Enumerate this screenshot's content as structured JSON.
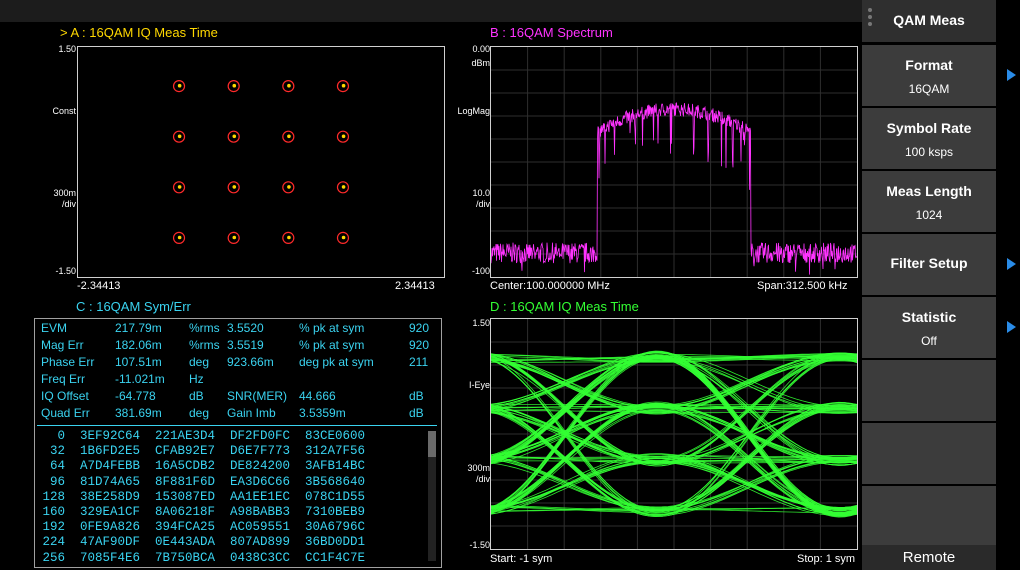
{
  "panel_a": {
    "title": ">  A :  16QAM  IQ Meas Time",
    "y_top": "1.50",
    "y_label": "Const",
    "scale_value": "300m",
    "scale_unit": "/div",
    "y_bottom": "-1.50",
    "x_left": "-2.34413",
    "x_right": "2.34413",
    "title_color": "#ffd800",
    "marker_color": "#ff2a2a",
    "point_color": "#ffd800"
  },
  "panel_b": {
    "title": "B :  16QAM  Spectrum",
    "ref_value": "0.00",
    "ref_unit": "dBm",
    "mode": "LogMag",
    "scale_value": "10.0",
    "scale_unit": "/div",
    "y_bottom": "-100",
    "center": "Center:100.000000 MHz",
    "span": "Span:312.500 kHz",
    "title_color": "#ff33ff",
    "trace_color": "#ff33ff"
  },
  "panel_c": {
    "title": "C :  16QAM  Sym/Err",
    "metrics": [
      [
        "EVM",
        "217.79m",
        "%rms",
        "3.5520",
        "% pk at sym",
        "920"
      ],
      [
        "Mag Err",
        "182.06m",
        "%rms",
        "3.5519",
        "% pk at sym",
        "920"
      ],
      [
        "Phase Err",
        "107.51m",
        "deg",
        "923.66m",
        "deg pk at sym",
        "211"
      ],
      [
        "Freq Err",
        "-11.021m",
        "Hz",
        "",
        "",
        ""
      ],
      [
        "IQ Offset",
        "-64.778",
        "dB",
        "SNR(MER)",
        "44.666",
        "dB"
      ],
      [
        "Quad Err",
        "381.69m",
        "deg",
        "Gain Imb",
        "3.5359m",
        "dB"
      ]
    ],
    "symbols": [
      "   0  3EF92C64  221AE3D4  DF2FD0FC  83CE0600",
      "  32  1B6FD2E5  CFAB92E7  D6E7F773  312A7F56",
      "  64  A7D4FEBB  16A5CDB2  DE824200  3AFB14BC",
      "  96  81D74A65  8F881F6D  EA3D6C66  3B568640",
      " 128  38E258D9  153087ED  AA1EE1EC  078C1D55",
      " 160  329EA1CF  8A06218F  A98BABB3  7310BEB9",
      " 192  0FE9A826  394FCA25  AC059551  30A6796C",
      " 224  47AF90DF  0E443ADA  807AD899  36BD0DD1",
      " 256  7085F4E6  7B750BCA  0438C3CC  CC1F4C7E"
    ],
    "title_color": "#3ad3f0"
  },
  "panel_d": {
    "title": "D :  16QAM  IQ Meas Time",
    "y_top": "1.50",
    "y_label": "I-Eye",
    "scale_value": "300m",
    "scale_unit": "/div",
    "y_bottom": "-1.50",
    "start": "Start: -1 sym",
    "stop": "Stop: 1 sym",
    "title_color": "#33ff33",
    "trace_color": "#33ff33"
  },
  "menu": {
    "title": "QAM Meas",
    "items": [
      {
        "label": "Format",
        "value": "16QAM",
        "arrow": true
      },
      {
        "label": "Symbol Rate",
        "value": "100 ksps",
        "arrow": false
      },
      {
        "label": "Meas Length",
        "value": "1024",
        "arrow": false
      },
      {
        "label": "Filter Setup",
        "value": "",
        "arrow": true
      },
      {
        "label": "Statistic",
        "value": "Off",
        "arrow": true
      },
      {
        "label": "",
        "value": "",
        "arrow": false
      },
      {
        "label": "",
        "value": "",
        "arrow": false
      },
      {
        "label": "",
        "value": "",
        "arrow": false
      }
    ],
    "status": "Remote",
    "arrow_color": "#2a8ce8"
  }
}
